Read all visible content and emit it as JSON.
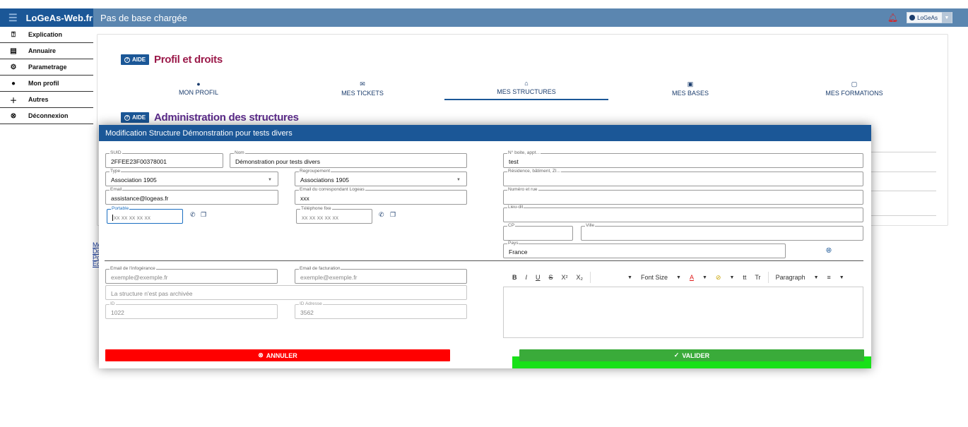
{
  "app": {
    "brand": "LoGeAs-Web.fr",
    "title": "Pas de base chargée",
    "user_label": "LoGeAs",
    "colors": {
      "primary": "#1b5797",
      "appbar": "#5b86b0",
      "danger": "#ff0000",
      "success": "#3aab3a",
      "section_title": "#9b1a4a",
      "section_title2": "#5b2a8a"
    }
  },
  "sidebar": {
    "items": [
      {
        "label": "Explication",
        "icon": "help-circle-icon"
      },
      {
        "label": "Annuaire",
        "icon": "book-icon"
      },
      {
        "label": "Parametrage",
        "icon": "gear-icon"
      },
      {
        "label": "Mon profil",
        "icon": "user-icon"
      },
      {
        "label": "Autres",
        "icon": "plus-icon"
      },
      {
        "label": "Déconnexion",
        "icon": "power-icon"
      }
    ]
  },
  "left_links": [
    "Me",
    "Do",
    "Po",
    "Ec"
  ],
  "page": {
    "aide_label": "AIDE",
    "section1_title": "Profil et droits",
    "section2_title": "Administration des structures",
    "tabs": [
      {
        "label": "MON PROFIL",
        "icon": "user-icon"
      },
      {
        "label": "MES TICKETS",
        "icon": "mail-icon"
      },
      {
        "label": "MES STRUCTURES",
        "icon": "home-icon"
      },
      {
        "label": "MES BASES",
        "icon": "chart-icon"
      },
      {
        "label": "MES FORMATIONS",
        "icon": "calendar-icon"
      }
    ]
  },
  "modal": {
    "title": "Modification Structure Démonstration pour tests divers",
    "fields": {
      "suid": {
        "label": "SUID",
        "value": "2FFEE23F00378001"
      },
      "nom": {
        "label": "Nom",
        "value": "Démonstration pour tests divers"
      },
      "type": {
        "label": "Type",
        "value": "Association 1905"
      },
      "regroupement": {
        "label": "Regroupement",
        "value": "Associations 1905"
      },
      "email": {
        "label": "Email",
        "value": "assistance@logeas.fr"
      },
      "email_corresp": {
        "label": "Email du correspondant Logeas",
        "value": "xxx"
      },
      "portable": {
        "label": "Portable",
        "placeholder": "xx xx xx xx xx"
      },
      "telephone": {
        "label": "Téléphone fixe",
        "placeholder": "xx xx xx xx xx"
      },
      "boite": {
        "label": "N° boite, appt...",
        "value": "test"
      },
      "residence": {
        "label": "Résidence, bâtiment, ZI...",
        "value": ""
      },
      "numero_rue": {
        "label": "Numéro et rue",
        "value": ""
      },
      "lieu_dit": {
        "label": "Lieu-dit",
        "value": ""
      },
      "cp": {
        "label": "CP",
        "value": ""
      },
      "ville": {
        "label": "Ville",
        "value": ""
      },
      "pays": {
        "label": "Pays",
        "value": "France"
      },
      "email_infogerance": {
        "label": "Email de l'infogérance",
        "placeholder": "exemple@exemple.fr"
      },
      "email_facturation": {
        "label": "Email de facturation",
        "placeholder": "exemple@exemple.fr"
      },
      "archive": {
        "value": "La structure n'est pas archivée"
      },
      "id": {
        "label": "ID",
        "value": "1022"
      },
      "id_adresse": {
        "label": "ID Adresse",
        "value": "3562"
      }
    },
    "editor_toolbar": {
      "bold": "B",
      "italic": "I",
      "underline": "U",
      "strike": "S",
      "superscript": "X²",
      "subscript": "X₂",
      "font_size": "Font Size",
      "font_color": "A",
      "highlight": "⊘",
      "case1": "tt",
      "case2": "Tr",
      "paragraph": "Paragraph",
      "align": "≡"
    },
    "cancel_label": "ANNULER",
    "validate_label": "VALIDER"
  }
}
